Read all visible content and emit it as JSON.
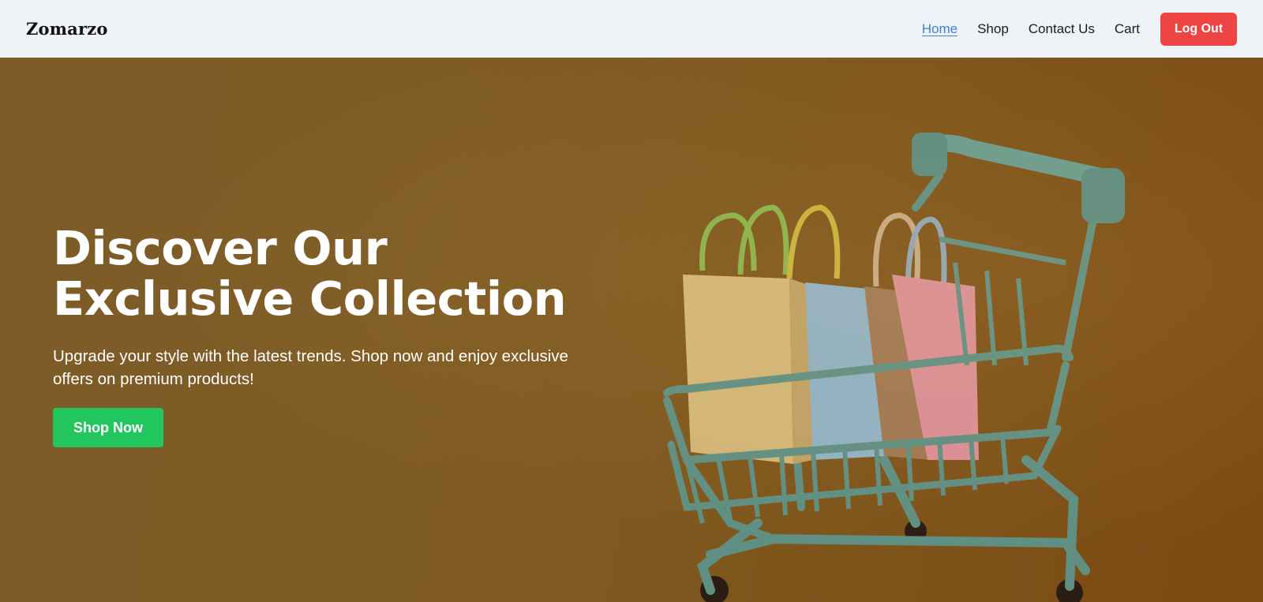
{
  "header": {
    "brand": "Zomarzo",
    "nav": {
      "home": "Home",
      "shop": "Shop",
      "contact": "Contact Us",
      "cart": "Cart",
      "logout": "Log Out"
    }
  },
  "hero": {
    "title": "Discover Our Exclusive Collection",
    "subtitle": "Upgrade your style with the latest trends. Shop now and enjoy exclusive offers on premium products!",
    "cta": "Shop Now"
  },
  "colors": {
    "accent_link": "#3b82d6",
    "logout_bg": "#ef4444",
    "cta_bg": "#22c55e",
    "navbar_bg": "#eff3f8"
  }
}
